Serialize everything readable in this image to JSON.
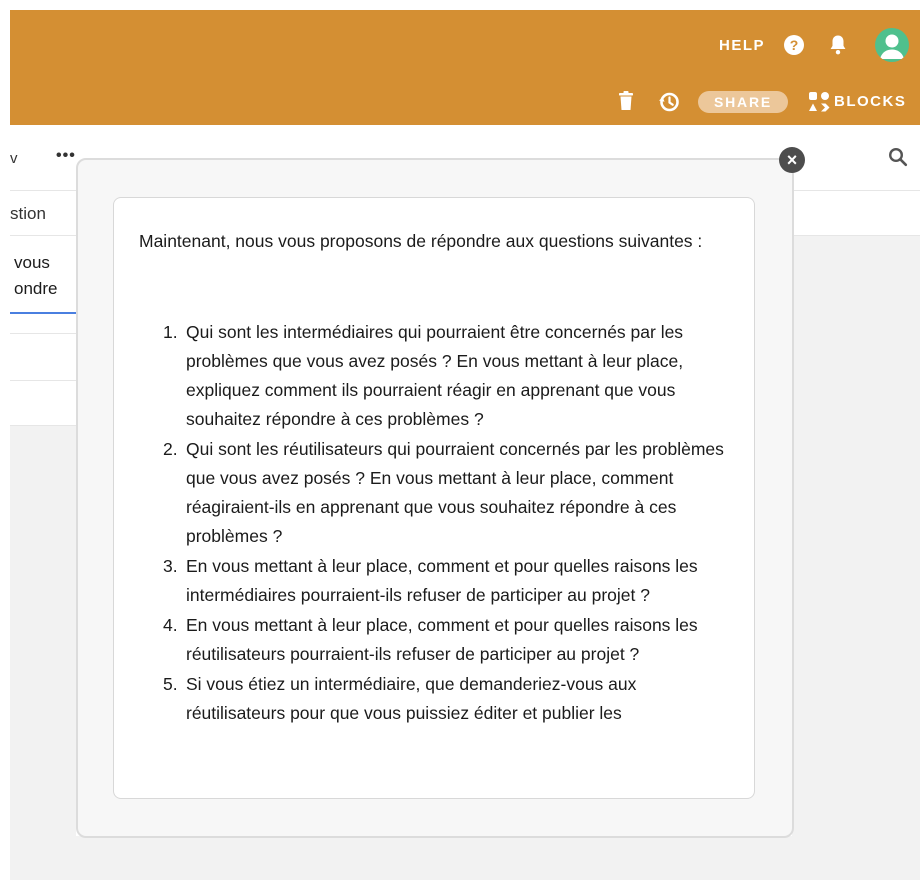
{
  "header": {
    "help_label": "HELP",
    "help_icon_glyph": "?",
    "share_label": "SHARE",
    "blocks_label": "BLOCKS",
    "icons": [
      "question-icon",
      "bell-icon",
      "avatar",
      "trash-icon",
      "history-icon",
      "blocks-icon"
    ],
    "background_color": "#d48f33"
  },
  "background": {
    "view_fragment": "v",
    "more_label": "•••",
    "column_header_fragment": "stion",
    "cell_line_1": "vous",
    "cell_line_2": "ondre",
    "accent_color": "#4a7fe0"
  },
  "modal": {
    "close_glyph": "×",
    "intro": "Maintenant, nous vous proposons de répondre aux questions suivantes :",
    "questions": [
      {
        "number": "1.",
        "text": "Qui sont les intermédiaires qui pourraient être concernés par les problèmes que vous avez posés ? En vous mettant à leur place, expliquez comment ils pourraient réagir en apprenant que vous souhaitez répondre à ces problèmes ?"
      },
      {
        "number": "2.",
        "text": "Qui sont les réutilisateurs qui pourraient concernés par les problèmes que vous avez posés ? En vous mettant à leur place, comment réagiraient-ils en apprenant que vous souhaitez répondre à ces problèmes ?"
      },
      {
        "number": "3.",
        "text": "En vous mettant à leur place, comment et pour quelles raisons les intermédiaires pourraient-ils refuser de participer au projet ?"
      },
      {
        "number": "4.",
        "text": "En vous mettant à leur place, comment et pour quelles raisons les réutilisateurs pourraient-ils refuser de participer au projet ?"
      },
      {
        "number": "5.",
        "text": "Si vous étiez un intermédiaire, que demanderiez-vous aux réutilisateurs pour que vous puissiez éditer et publier les"
      }
    ]
  }
}
